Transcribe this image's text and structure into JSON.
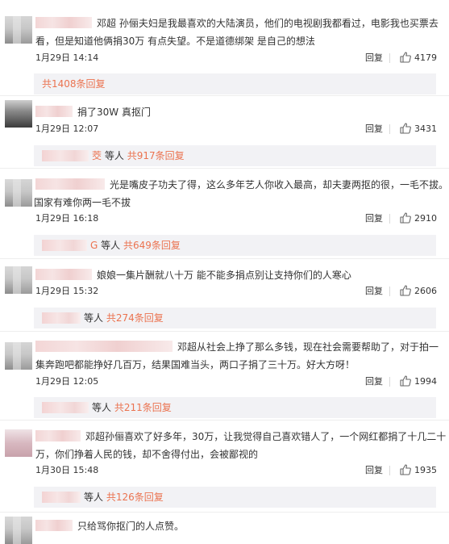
{
  "colors": {
    "accent": "#eb7350",
    "subreply_bg": "#f2f2f5",
    "text": "#333333"
  },
  "labels": {
    "reply": "回复",
    "others": "等人"
  },
  "comments": [
    {
      "text_line1": "邓超 孙俪夫妇是我最喜欢的大陆演员，他们的电视剧我都看过，电影我也买票去",
      "text_line2": "看，但是知道他俩捐30万 有点失望。不是道德绑架 是自己的想法",
      "date": "1月29日 14:14",
      "likes": "4179",
      "replies_prefix": "",
      "replies_text": "共1408条回复"
    },
    {
      "text_line1": "捐了30W 真抠门",
      "date": "1月29日 12:07",
      "likes": "3431",
      "replies_prefix": "茭",
      "replies_text": "共917条回复"
    },
    {
      "text_line1": "光是嘴皮子功夫了得，这么多年艺人你收入最高，却夫妻两抠的很，一毛不拔。",
      "text_line2": "国家有难你两一毛不拔",
      "date": "1月29日 16:18",
      "likes": "2910",
      "replies_prefix": "G",
      "replies_text": "共649条回复"
    },
    {
      "text_line1": "娘娘一集片酬就八十万 能不能多捐点别让支持你们的人寒心",
      "date": "1月29日 15:32",
      "likes": "2606",
      "replies_prefix": "",
      "replies_text": "共274条回复"
    },
    {
      "text_line1": "邓超从社会上挣了那么多钱，现在社会需要帮助了，对于拍一",
      "text_line2": "集奔跑吧都能挣好几百万，结果国难当头，两口子捐了三十万。好大方呀！",
      "date": "1月29日 12:05",
      "likes": "1994",
      "replies_prefix": "",
      "replies_text": "共211条回复"
    },
    {
      "text_line1": "邓超孙俪喜欢了好多年，30万，让我觉得自己喜欢错人了，一个网红都捐了十几二十",
      "text_line2": "万，你们挣着人民的钱，却不舍得付出，会被鄙视的",
      "date": "1月30日 15:48",
      "likes": "1935",
      "replies_prefix": "",
      "replies_text": "共126条回复"
    },
    {
      "text_line1": "只给骂你抠门的人点赞。"
    }
  ]
}
